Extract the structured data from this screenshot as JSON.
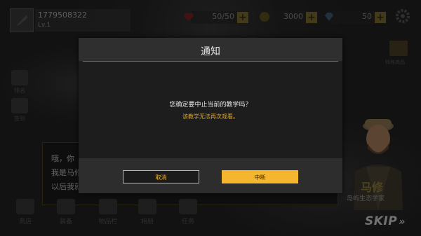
{
  "player": {
    "id": "1779508322",
    "level": "Lv.1"
  },
  "resources": {
    "health": "50/50",
    "coins": "3000",
    "gems": "50"
  },
  "dialog": {
    "title": "通知",
    "message": "您确定要中止当前的教学吗？",
    "warning": "该教学无法再次观看。",
    "cancel_label": "取消",
    "confirm_label": "中断"
  },
  "tutorial": {
    "lines": [
      "哦，你",
      "我是马修",
      "以后我就"
    ]
  },
  "npc": {
    "name": "马修",
    "title": "岛屿生态学家"
  },
  "side": {
    "items": [
      "排名",
      "签到"
    ],
    "gift_label": "特殊商品"
  },
  "nav": {
    "items": [
      "商店",
      "装备",
      "物品栏",
      "相册",
      "任务"
    ]
  },
  "skip_label": "SKIP",
  "colors": {
    "accent": "#f3b62e",
    "warning_text": "#e0a825"
  }
}
